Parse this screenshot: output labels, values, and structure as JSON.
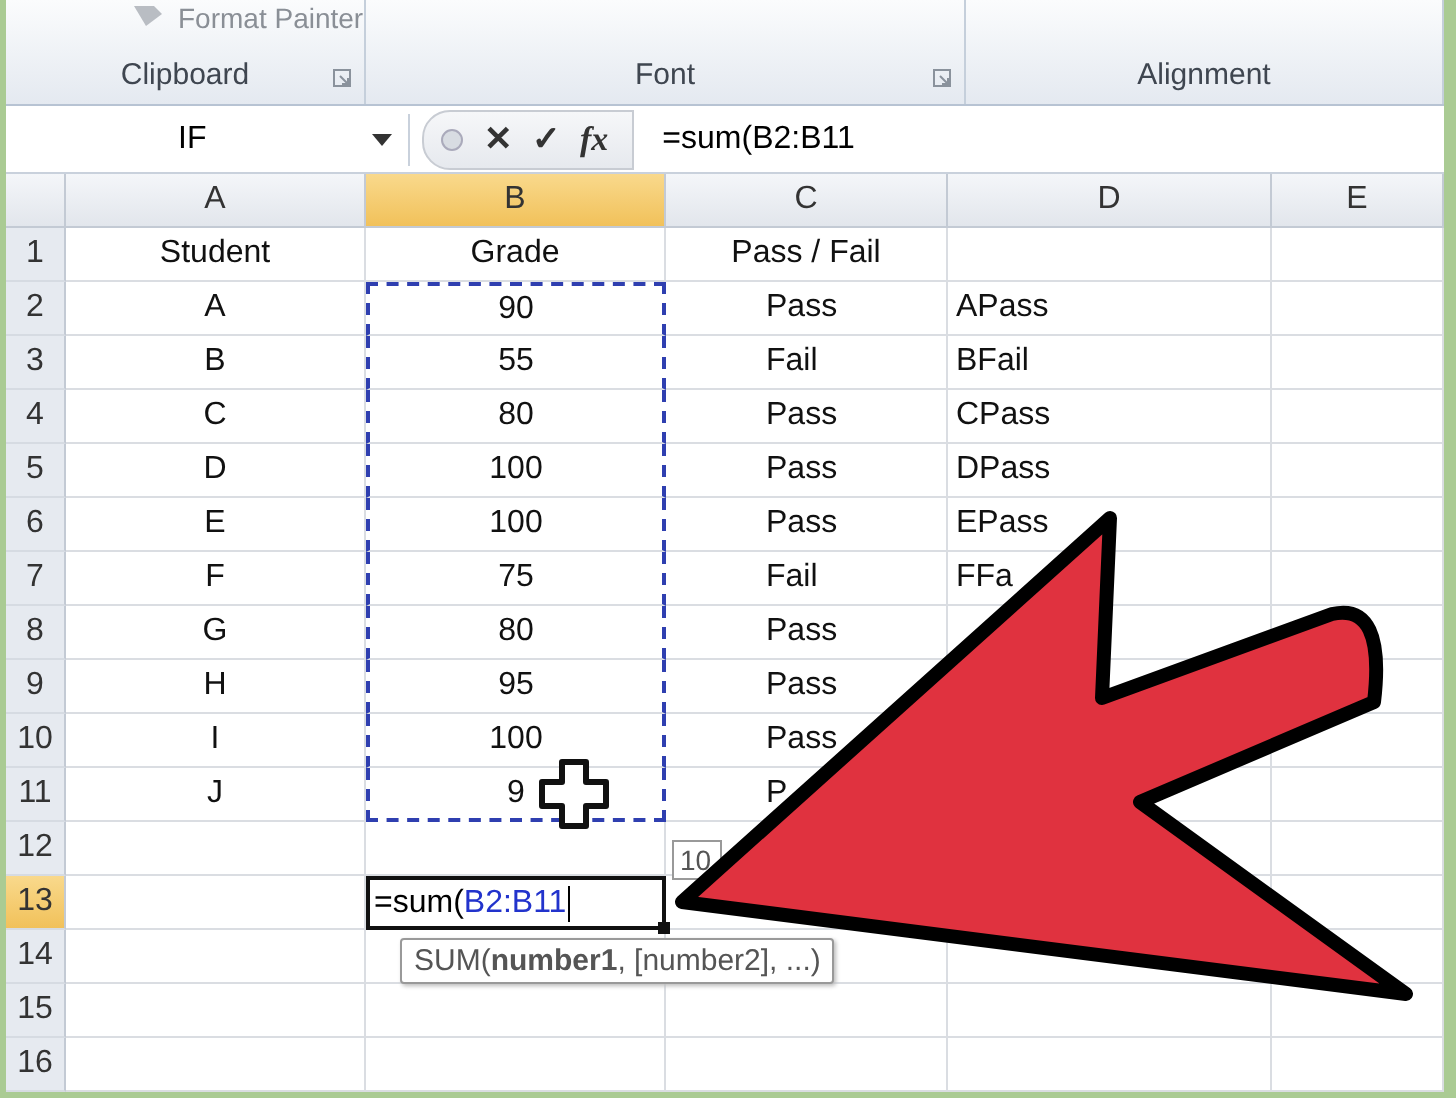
{
  "ribbon": {
    "top_item": "Format Painter",
    "groups": [
      {
        "label": "Clipboard",
        "launcher": true
      },
      {
        "label": "Font",
        "launcher": true
      },
      {
        "label": "Alignment",
        "launcher": false
      }
    ]
  },
  "formula_bar": {
    "name_box": "IF",
    "cancel": "✕",
    "enter": "✓",
    "function_label": "fx",
    "formula": "=sum(B2:B11"
  },
  "columns": [
    {
      "label": "A",
      "selected": false
    },
    {
      "label": "B",
      "selected": true
    },
    {
      "label": "C",
      "selected": false
    },
    {
      "label": "D",
      "selected": false
    },
    {
      "label": "E",
      "selected": false
    }
  ],
  "rows": [
    {
      "label": "1",
      "selected": false,
      "in_range": false,
      "cells": {
        "A": "Student",
        "B": "Grade",
        "C": "Pass / Fail"
      }
    },
    {
      "label": "2",
      "selected": false,
      "in_range": true,
      "cells": {
        "A": "A",
        "B": "90",
        "C": "Pass",
        "D": "APass"
      }
    },
    {
      "label": "3",
      "selected": false,
      "in_range": true,
      "cells": {
        "A": "B",
        "B": "55",
        "C": "Fail",
        "D": "BFail"
      }
    },
    {
      "label": "4",
      "selected": false,
      "in_range": true,
      "cells": {
        "A": "C",
        "B": "80",
        "C": "Pass",
        "D": "CPass"
      }
    },
    {
      "label": "5",
      "selected": false,
      "in_range": true,
      "cells": {
        "A": "D",
        "B": "100",
        "C": "Pass",
        "D": "DPass"
      }
    },
    {
      "label": "6",
      "selected": false,
      "in_range": true,
      "cells": {
        "A": "E",
        "B": "100",
        "C": "Pass",
        "D": "EPass"
      }
    },
    {
      "label": "7",
      "selected": false,
      "in_range": true,
      "cells": {
        "A": "F",
        "B": "75",
        "C": "Fail",
        "D": "FFa"
      }
    },
    {
      "label": "8",
      "selected": false,
      "in_range": true,
      "cells": {
        "A": "G",
        "B": "80",
        "C": "Pass"
      }
    },
    {
      "label": "9",
      "selected": false,
      "in_range": true,
      "cells": {
        "A": "H",
        "B": "95",
        "C": "Pass"
      }
    },
    {
      "label": "10",
      "selected": false,
      "in_range": true,
      "cells": {
        "A": "I",
        "B": "100",
        "C": "Pass"
      }
    },
    {
      "label": "11",
      "selected": false,
      "in_range": true,
      "cells": {
        "A": "J",
        "B": "9",
        "C": "P"
      }
    },
    {
      "label": "12",
      "selected": false,
      "in_range": false,
      "cells": {}
    },
    {
      "label": "13",
      "selected": true,
      "in_range": false,
      "cells": {},
      "editor": {
        "text": "=sum(",
        "ref": "B2:B11"
      }
    },
    {
      "label": "14",
      "selected": false,
      "in_range": false,
      "cells": {}
    },
    {
      "label": "15",
      "selected": false,
      "in_range": false,
      "cells": {}
    },
    {
      "label": "16",
      "selected": false,
      "in_range": false,
      "cells": {}
    }
  ],
  "range_hint": "10",
  "function_tip": "SUM(**number1**, [number2], ...)"
}
